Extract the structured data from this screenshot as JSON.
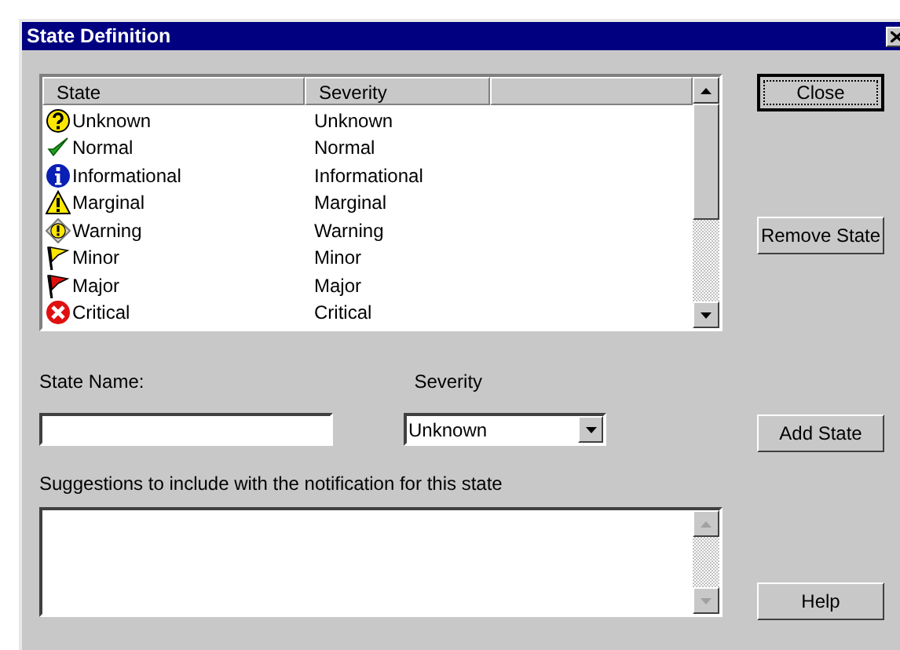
{
  "window": {
    "title": "State Definition"
  },
  "state_list": {
    "columns": [
      "State",
      "Severity"
    ],
    "rows": [
      {
        "state": "Unknown",
        "severity": "Unknown",
        "kind": "unknown"
      },
      {
        "state": "Normal",
        "severity": "Normal",
        "kind": "normal"
      },
      {
        "state": "Informational",
        "severity": "Informational",
        "kind": "informational"
      },
      {
        "state": "Marginal",
        "severity": "Marginal",
        "kind": "marginal"
      },
      {
        "state": "Warning",
        "severity": "Warning",
        "kind": "warning"
      },
      {
        "state": "Minor",
        "severity": "Minor",
        "kind": "minor"
      },
      {
        "state": "Major",
        "severity": "Major",
        "kind": "major"
      },
      {
        "state": "Critical",
        "severity": "Critical",
        "kind": "critical"
      }
    ]
  },
  "state_name": {
    "label": "State Name:"
  },
  "severity": {
    "label": "Severity",
    "value": "Unknown"
  },
  "suggestions": {
    "label": "Suggestions to include with the notification for this state"
  },
  "buttons": [
    {
      "label": "Close",
      "default": true
    },
    {
      "label": "Remove State",
      "default": false
    },
    {
      "label": "Add State",
      "default": false
    },
    {
      "label": "Help",
      "default": false
    }
  ]
}
